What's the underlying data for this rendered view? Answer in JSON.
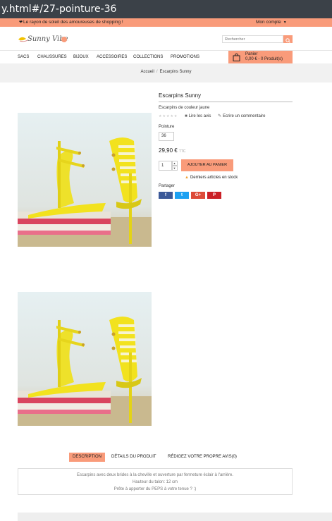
{
  "browser": {
    "url_fragment": "y.html#/27-pointure-36"
  },
  "topbar": {
    "promo": "Le rayon de soleil des amoureuses de shopping !",
    "account": "Mon compte"
  },
  "header": {
    "logo_text": "Sunny Vibes",
    "search_placeholder": "Rechercher",
    "menu": [
      "SACS",
      "CHAUSSURES",
      "BIJOUX",
      "ACCESSOIRES",
      "COLLECTIONS",
      "PROMOTIONS"
    ],
    "cart": {
      "title": "Panier",
      "summary": "0,00 € - 0 Produit(s)"
    }
  },
  "breadcrumb": {
    "home": "Accueil",
    "current": "Escarpins Sunny"
  },
  "product": {
    "name": "Escarpins Sunny",
    "short_desc": "Escarpins de couleur jaune",
    "read_reviews": "Lire les avis",
    "write_review": "Ecrire un commentaire",
    "size_label": "Pointure",
    "size_value": "36",
    "price": "29,90 €",
    "tax_label": "TTC",
    "qty": "1",
    "add_to_cart": "AJOUTER AU PANIER",
    "stock_note": "Derniers articles en stock",
    "share_label": "Partager",
    "share_buttons": [
      {
        "label": "f",
        "icon": "facebook-icon",
        "color": "#3b5998"
      },
      {
        "label": "t",
        "icon": "twitter-icon",
        "color": "#1da1f2"
      },
      {
        "label": "G+",
        "icon": "google-plus-icon",
        "color": "#dd4b39"
      },
      {
        "label": "P",
        "icon": "pinterest-icon",
        "color": "#cb2027"
      }
    ]
  },
  "tabs": {
    "items": [
      "DESCRIPTION",
      "DÉTAILS DU PRODUIT",
      "RÉDIGEZ VOTRE PROPRE AVIS(0)"
    ],
    "active": "DESCRIPTION",
    "description_lines": [
      "Escarpins avec deux brides à la cheville et ouverture par fermeture éclair à l'arrière.",
      "Hauteur du talon: 12 cm",
      "Prête à apporter du PEPS à votre tenue ? :)"
    ]
  },
  "colors": {
    "accent": "#f99b7a",
    "shoe_yellow": "#f2e21e"
  }
}
